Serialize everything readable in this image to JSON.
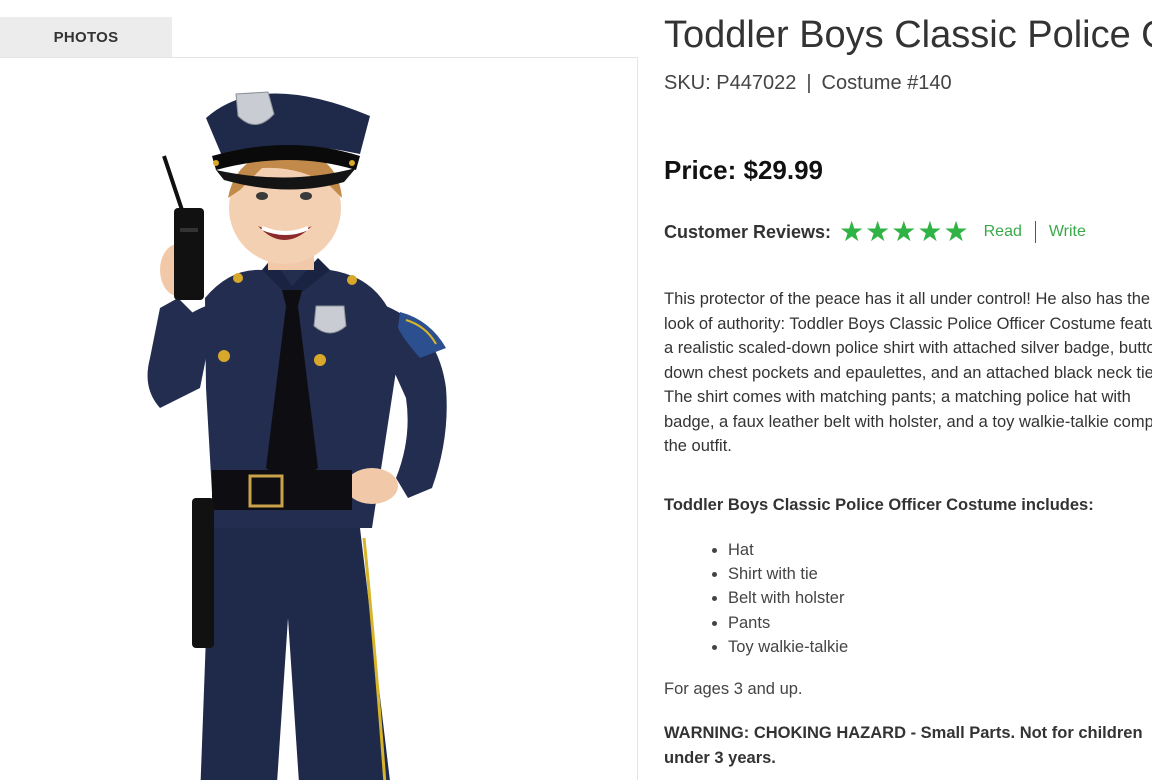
{
  "photos_tab": {
    "label": "PHOTOS"
  },
  "product": {
    "title": "Toddler Boys Classic Police Officer Costume",
    "sku_label": "SKU: P447022",
    "separator": "|",
    "costume_label": "Costume #140",
    "price": "Price: $29.99",
    "reviews": {
      "label": "Customer Reviews:",
      "rating": 5,
      "max_rating": 5,
      "star_color": "#2fb344",
      "read_label": "Read",
      "divider": "|",
      "write_label": "Write",
      "link_color": "#3aa84a"
    },
    "description": "This protector of the peace has it all under control! He also has the look of authority: Toddler Boys Classic Police Officer Costume features a realistic scaled-down police shirt with attached silver badge, button-down chest pockets and epaulettes, and an attached black neck tie. The shirt comes with matching pants; a matching police hat with badge, a faux leather belt with holster, and a toy walkie-talkie complete the outfit.",
    "includes_heading": "Toddler Boys Classic Police Officer Costume includes:",
    "includes": [
      "Hat",
      "Shirt with tie",
      "Belt with holster",
      "Pants",
      "Toy walkie-talkie"
    ],
    "ages": "For ages 3 and up.",
    "warning": "WARNING: CHOKING HAZARD - Small Parts. Not for children under 3 years."
  },
  "photo": {
    "icon": "product-photo-child-police-costume",
    "uniform_color": "#1f2a4a",
    "stripe_color": "#d8b42a"
  }
}
